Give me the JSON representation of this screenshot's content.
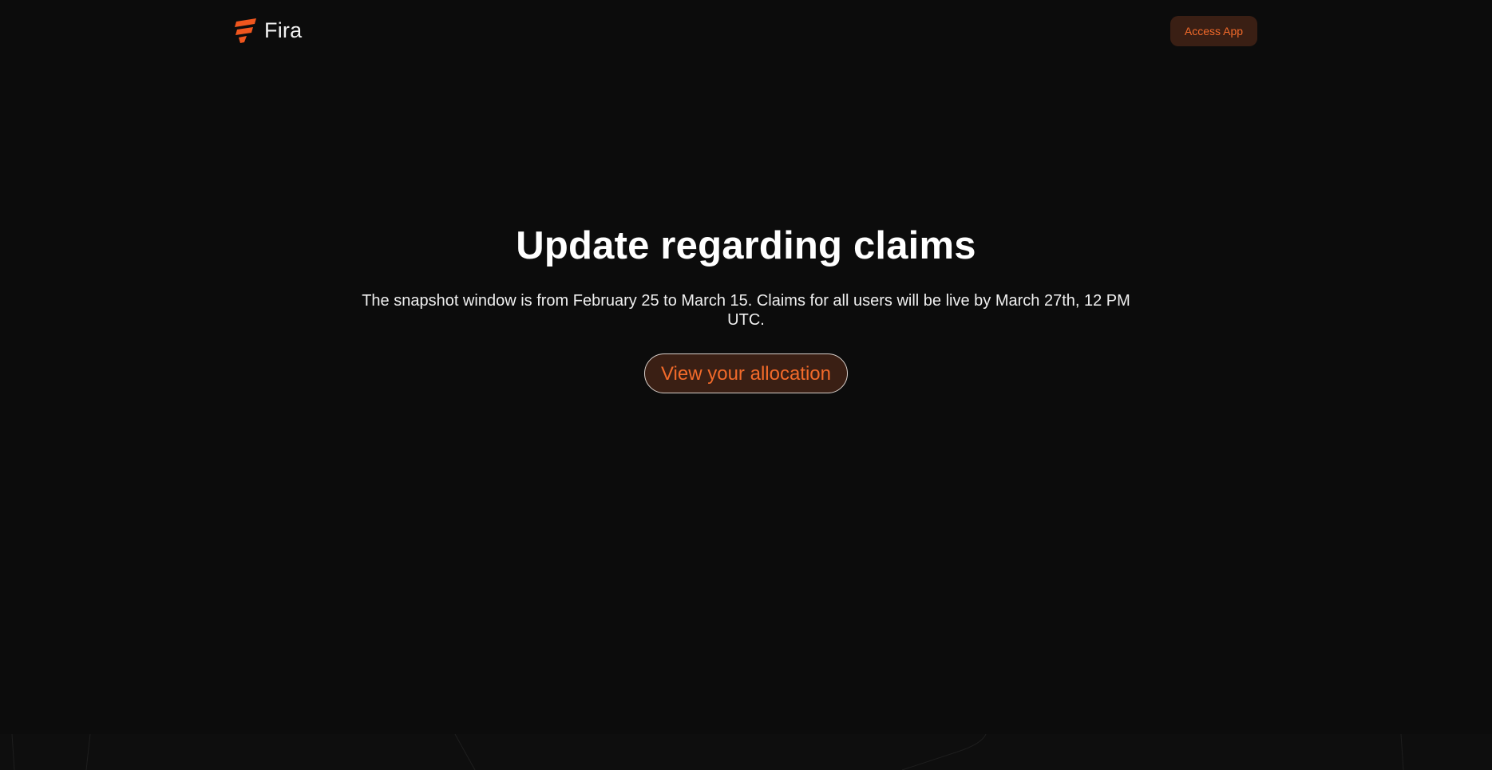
{
  "header": {
    "brand_name": "Fira",
    "logo_icon": "fira-logo-icon",
    "access_button_label": "Access App"
  },
  "hero": {
    "title": "Update regarding claims",
    "description": "The snapshot window is from February 25 to March 15. Claims for all users will be live by March 27th, 12 PM UTC.",
    "cta_label": "View your allocation"
  },
  "colors": {
    "background": "#0c0c0c",
    "accent": "#f26a2a",
    "button_bg": "#3a1f14",
    "text": "#ffffff"
  }
}
